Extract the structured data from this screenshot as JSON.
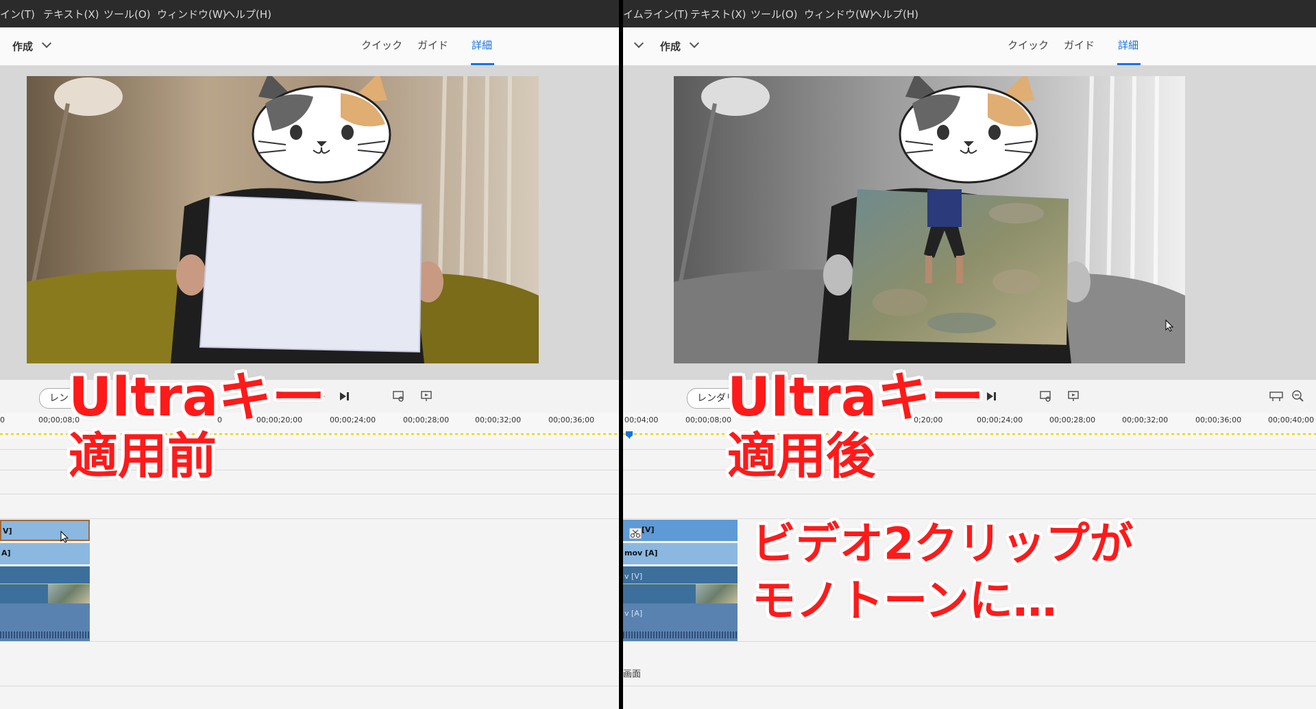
{
  "left": {
    "menu": [
      "イン(T)",
      "テキスト(X)",
      "ツール(O)",
      "ウィンドウ(W)",
      "ヘルプ(H)"
    ],
    "create_label": "作成",
    "tabs": [
      "クイック",
      "ガイド",
      "詳細"
    ],
    "render_label": "レン",
    "timecodes": [
      "0",
      "00;00;08;0",
      "0",
      "00;00;20;00",
      "00;00;24;00",
      "00;00;28;00",
      "00;00;32;00",
      "00;00;36;00"
    ],
    "clip_labels": [
      "V]",
      "A]"
    ],
    "overlay_line1": "Ultraキー",
    "overlay_line2": "適用前"
  },
  "right": {
    "menu": [
      "イムライン(T)",
      "テキスト(X)",
      "ツール(O)",
      "ウィンドウ(W)",
      "ヘルプ(H)"
    ],
    "create_label": "作成",
    "tabs": [
      "クイック",
      "ガイド",
      "詳細"
    ],
    "render_label": "レンダリ",
    "timecodes": [
      "00;04;00",
      "00;00;08;00",
      "0;20;00",
      "00;00;24;00",
      "00;00;28;00",
      "00;00;32;00",
      "00;00;36;00",
      "00;00;40;00"
    ],
    "clip_labels": [
      "[V]",
      "mov [A]",
      "v [V]",
      "v [A]"
    ],
    "bottom_label": "画面",
    "overlay_line1": "Ultraキー",
    "overlay_line2": "適用後",
    "note_line1": "ビデオ2クリップが",
    "note_line2": "モノトーンに…"
  },
  "colors": {
    "accent": "#1473e6",
    "overlay_red": "#ff1a1a",
    "clip_blue": "#8ab8e0",
    "clip_dark": "#3d6f9c"
  }
}
